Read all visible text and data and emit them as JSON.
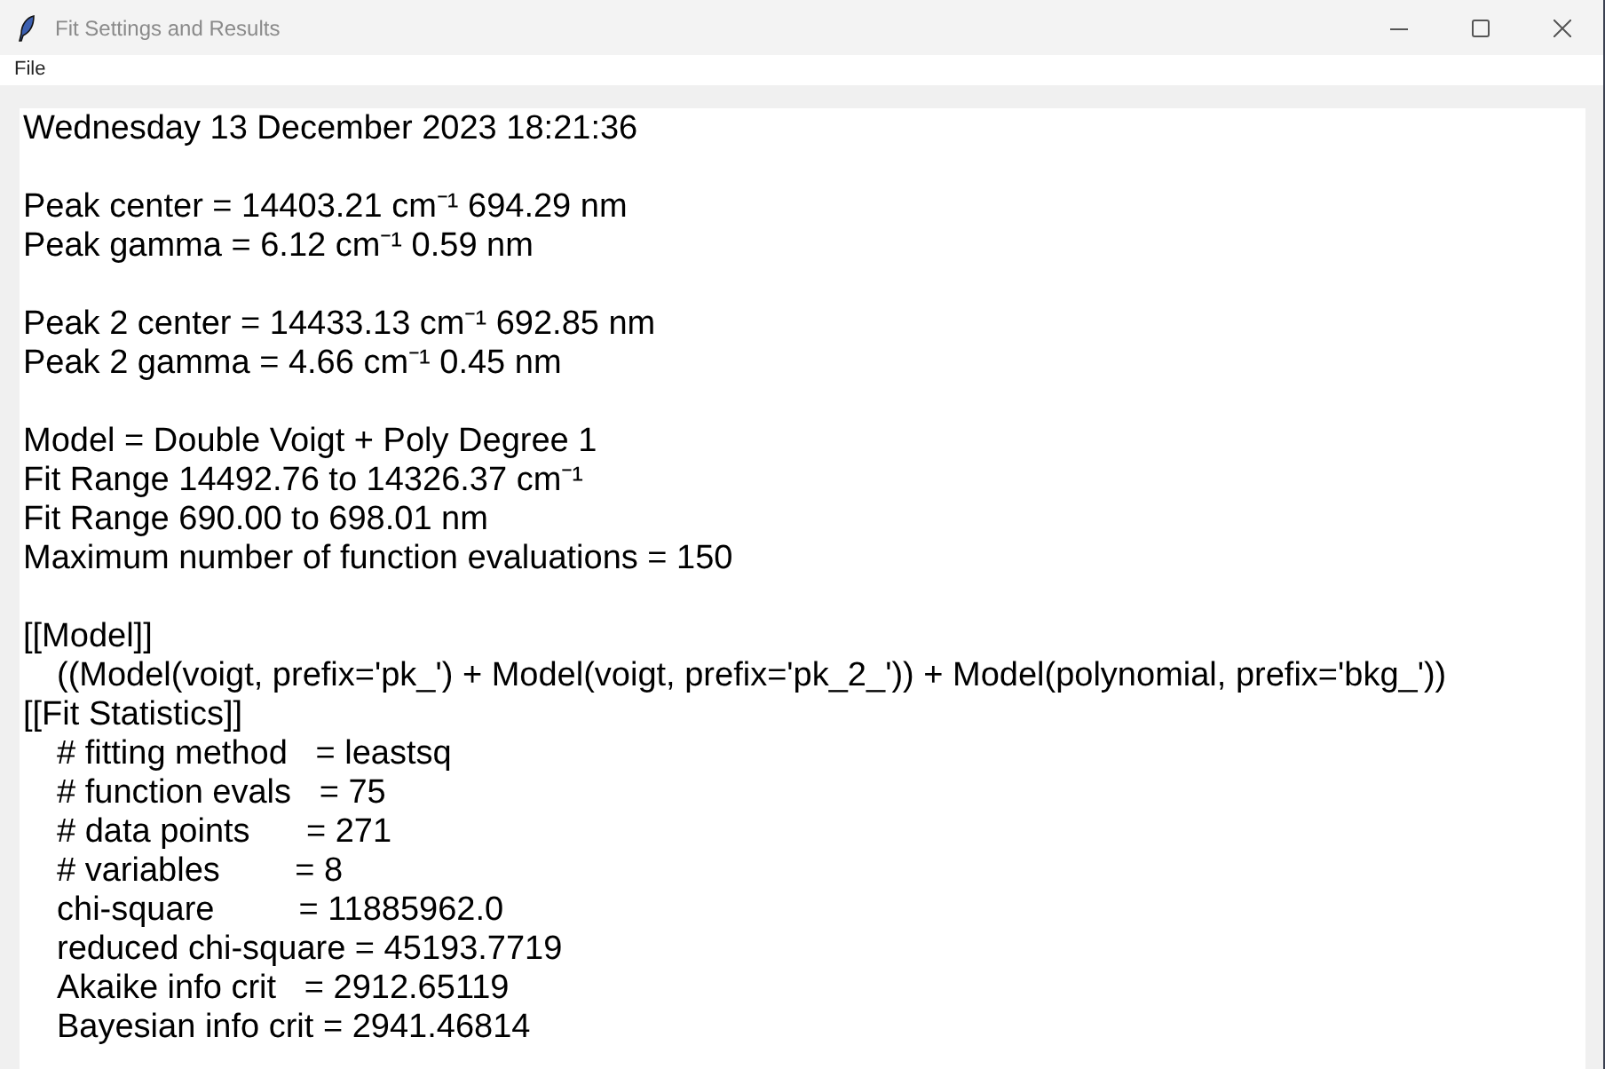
{
  "window": {
    "title": "Fit Settings and Results"
  },
  "menu": [
    {
      "label": "File"
    }
  ],
  "report": {
    "sections": [
      {
        "lines": [
          {
            "text": "Wednesday 13 December 2023 18:21:36"
          }
        ]
      },
      {
        "lines": [
          {
            "text": "Peak center = 14403.21 cm⁻¹ 694.29 nm"
          },
          {
            "text": "Peak gamma = 6.12 cm⁻¹ 0.59 nm"
          }
        ]
      },
      {
        "lines": [
          {
            "text": "Peak 2 center = 14433.13 cm⁻¹ 692.85 nm"
          },
          {
            "text": "Peak 2 gamma = 4.66 cm⁻¹ 0.45 nm"
          }
        ]
      },
      {
        "lines": [
          {
            "text": "Model = Double Voigt + Poly Degree 1"
          },
          {
            "text": "Fit Range 14492.76 to 14326.37 cm⁻¹"
          },
          {
            "text": "Fit Range 690.00 to 698.01 nm"
          },
          {
            "text": "Maximum number of function evaluations = 150"
          }
        ]
      },
      {
        "lines": [
          {
            "text": "[[Model]]",
            "children": [
              {
                "text": "((Model(voigt, prefix='pk_') + Model(voigt, prefix='pk_2_')) + Model(polynomial, prefix='bkg_'))"
              }
            ]
          },
          {
            "text": "[[Fit Statistics]]",
            "children": [
              {
                "text": "# fitting method   = leastsq"
              },
              {
                "text": "# function evals   = 75"
              },
              {
                "text": "# data points      = 271"
              },
              {
                "text": "# variables        = 8"
              },
              {
                "text": "chi-square         = 11885962.0"
              },
              {
                "text": "reduced chi-square = 45193.7719"
              },
              {
                "text": "Akaike info crit   = 2912.65119"
              },
              {
                "text": "Bayesian info crit = 2941.46814"
              }
            ]
          }
        ]
      }
    ]
  }
}
